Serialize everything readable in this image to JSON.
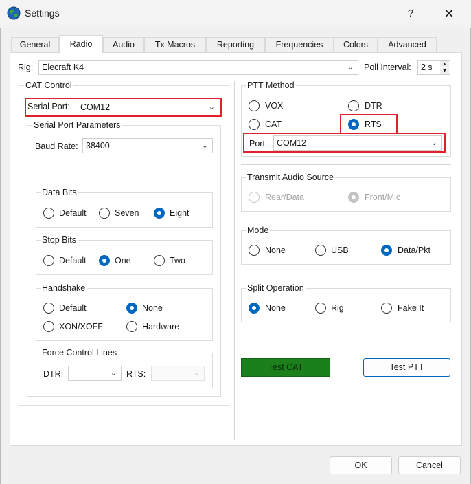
{
  "window": {
    "title": "Settings",
    "help": "?",
    "close": "✕"
  },
  "tabs": [
    "General",
    "Radio",
    "Audio",
    "Tx Macros",
    "Reporting",
    "Frequencies",
    "Colors",
    "Advanced"
  ],
  "rig": {
    "label": "Rig:",
    "value": "Elecraft K4"
  },
  "poll": {
    "label": "Poll Interval:",
    "value": "2 s"
  },
  "cat": {
    "title": "CAT Control",
    "serial_port_label": "Serial Port:",
    "serial_port_value": "COM12",
    "spp_title": "Serial Port Parameters",
    "baud_label": "Baud Rate:",
    "baud_value": "38400",
    "data_bits": {
      "title": "Data Bits",
      "default": "Default",
      "seven": "Seven",
      "eight": "Eight"
    },
    "stop_bits": {
      "title": "Stop Bits",
      "default": "Default",
      "one": "One",
      "two": "Two"
    },
    "handshake": {
      "title": "Handshake",
      "default": "Default",
      "none": "None",
      "xonxoff": "XON/XOFF",
      "hardware": "Hardware"
    },
    "force": {
      "title": "Force Control Lines",
      "dtr": "DTR:",
      "rts": "RTS:",
      "dtr_value": "",
      "rts_value": ""
    }
  },
  "ptt": {
    "title": "PTT Method",
    "vox": "VOX",
    "dtr": "DTR",
    "cat": "CAT",
    "rts": "RTS",
    "port_label": "Port:",
    "port_value": "COM12"
  },
  "tas": {
    "title": "Transmit Audio Source",
    "rear": "Rear/Data",
    "front": "Front/Mic"
  },
  "mode": {
    "title": "Mode",
    "none": "None",
    "usb": "USB",
    "data": "Data/Pkt"
  },
  "split": {
    "title": "Split Operation",
    "none": "None",
    "rig": "Rig",
    "fake": "Fake It"
  },
  "buttons": {
    "test_cat": "Test CAT",
    "test_ptt": "Test PTT",
    "ok": "OK",
    "cancel": "Cancel"
  },
  "colors": {
    "accent": "#0067c0",
    "test_cat_green": "#1b7f1b",
    "highlight_red": "#e0202a"
  }
}
